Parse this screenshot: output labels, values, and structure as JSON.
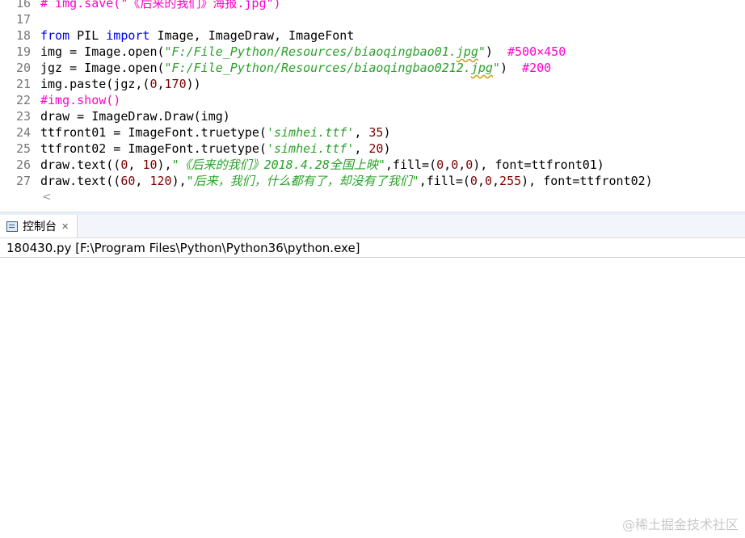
{
  "editor": {
    "lines": [
      {
        "n": "16",
        "tokens": [
          {
            "t": "# img.save(\"《后来的我们》海报.jpg\")",
            "c": "cmt"
          }
        ]
      },
      {
        "n": "17",
        "tokens": []
      },
      {
        "n": "18",
        "tokens": [
          {
            "t": "from",
            "c": "kw"
          },
          {
            "t": " PIL ",
            "c": "plain"
          },
          {
            "t": "import",
            "c": "kw"
          },
          {
            "t": " Image, ImageDraw, ImageFont",
            "c": "plain"
          }
        ]
      },
      {
        "n": "19",
        "tokens": [
          {
            "t": "img = Image.open(",
            "c": "plain"
          },
          {
            "t": "\"F:/File_Python/Resources/biaoqingbao01.",
            "c": "str"
          },
          {
            "t": "jpg",
            "c": "str-squig"
          },
          {
            "t": "\"",
            "c": "str"
          },
          {
            "t": ")  ",
            "c": "plain"
          },
          {
            "t": "#500×450",
            "c": "cmt"
          }
        ]
      },
      {
        "n": "20",
        "tokens": [
          {
            "t": "jgz = Image.open(",
            "c": "plain"
          },
          {
            "t": "\"F:/File_Python/Resources/biaoqingbao0212.",
            "c": "str"
          },
          {
            "t": "jpg",
            "c": "str-squig"
          },
          {
            "t": "\"",
            "c": "str"
          },
          {
            "t": ")  ",
            "c": "plain"
          },
          {
            "t": "#200",
            "c": "cmt"
          }
        ]
      },
      {
        "n": "21",
        "tokens": [
          {
            "t": "img.paste(jgz,(",
            "c": "plain"
          },
          {
            "t": "0",
            "c": "num"
          },
          {
            "t": ",",
            "c": "plain"
          },
          {
            "t": "170",
            "c": "num"
          },
          {
            "t": "))",
            "c": "plain"
          }
        ]
      },
      {
        "n": "22",
        "tokens": [
          {
            "t": "#img.show()",
            "c": "cmt"
          }
        ]
      },
      {
        "n": "23",
        "tokens": [
          {
            "t": "draw = ImageDraw.Draw(img)",
            "c": "plain"
          }
        ]
      },
      {
        "n": "24",
        "tokens": [
          {
            "t": "ttfront01 = ImageFont.truetype(",
            "c": "plain"
          },
          {
            "t": "'simhei.ttf'",
            "c": "str"
          },
          {
            "t": ", ",
            "c": "plain"
          },
          {
            "t": "35",
            "c": "num"
          },
          {
            "t": ")",
            "c": "plain"
          }
        ]
      },
      {
        "n": "25",
        "tokens": [
          {
            "t": "ttfront02 = ImageFont.truetype(",
            "c": "plain"
          },
          {
            "t": "'simhei.ttf'",
            "c": "str"
          },
          {
            "t": ", ",
            "c": "plain"
          },
          {
            "t": "20",
            "c": "num"
          },
          {
            "t": ")",
            "c": "plain"
          }
        ]
      },
      {
        "n": "26",
        "tokens": [
          {
            "t": "draw.text((",
            "c": "plain"
          },
          {
            "t": "0",
            "c": "num"
          },
          {
            "t": ", ",
            "c": "plain"
          },
          {
            "t": "10",
            "c": "num"
          },
          {
            "t": "),",
            "c": "plain"
          },
          {
            "t": "\"《后来的我们》2018.4.28全国上映\"",
            "c": "str"
          },
          {
            "t": ",fill=(",
            "c": "plain"
          },
          {
            "t": "0",
            "c": "num"
          },
          {
            "t": ",",
            "c": "plain"
          },
          {
            "t": "0",
            "c": "num"
          },
          {
            "t": ",",
            "c": "plain"
          },
          {
            "t": "0",
            "c": "num"
          },
          {
            "t": "), font=ttfront01)",
            "c": "plain"
          }
        ]
      },
      {
        "n": "27",
        "tokens": [
          {
            "t": "draw.text((",
            "c": "plain"
          },
          {
            "t": "60",
            "c": "num"
          },
          {
            "t": ", ",
            "c": "plain"
          },
          {
            "t": "120",
            "c": "num"
          },
          {
            "t": "),",
            "c": "plain"
          },
          {
            "t": "\"后来，我们，什么都有了，却没有了我们\"",
            "c": "str"
          },
          {
            "t": ",fill=(",
            "c": "plain"
          },
          {
            "t": "0",
            "c": "num"
          },
          {
            "t": ",",
            "c": "plain"
          },
          {
            "t": "0",
            "c": "num"
          },
          {
            "t": ",",
            "c": "plain"
          },
          {
            "t": "255",
            "c": "num"
          },
          {
            "t": "), font=ttfront02)",
            "c": "plain"
          }
        ]
      }
    ],
    "scroll_left_glyph": "<"
  },
  "console": {
    "tab_label": "控制台",
    "close_glyph": "✕",
    "status": "180430.py [F:\\Program Files\\Python\\Python36\\python.exe]"
  },
  "watermark": "@稀土掘金技术社区",
  "colors": {
    "keyword": "#0000ff",
    "string": "#2aa12a",
    "number": "#800000",
    "comment": "#ff00cc",
    "line_number": "#787878"
  },
  "icons": {
    "console_tab": "console-icon",
    "close_tab": "close-icon",
    "scroll_left": "chevron-left-icon"
  }
}
